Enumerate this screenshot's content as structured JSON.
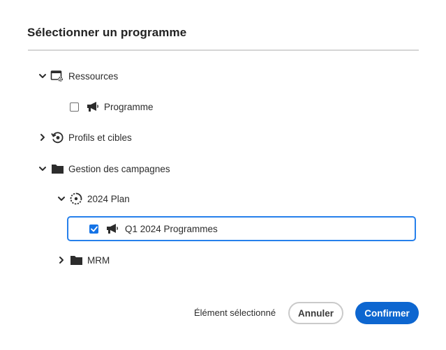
{
  "dialog": {
    "title": "Sélectionner un programme"
  },
  "tree": {
    "resources": {
      "label": "Ressources",
      "expanded": true,
      "icon": "resource-settings-icon",
      "children": {
        "programme": {
          "label": "Programme",
          "checked": false,
          "icon": "megaphone-icon"
        }
      }
    },
    "profiles": {
      "label": "Profils et cibles",
      "expanded": false,
      "icon": "history-target-icon"
    },
    "campaigns": {
      "label": "Gestion des campagnes",
      "expanded": true,
      "icon": "folder-icon",
      "children": {
        "plan": {
          "label": "2024 Plan",
          "expanded": true,
          "icon": "plan-target-icon",
          "children": {
            "q1": {
              "label": "Q1 2024 Programmes",
              "checked": true,
              "icon": "megaphone-icon"
            }
          }
        },
        "mrm": {
          "label": "MRM",
          "expanded": false,
          "icon": "folder-icon"
        }
      }
    }
  },
  "footer": {
    "status": "Élément sélectionné",
    "cancel_label": "Annuler",
    "confirm_label": "Confirmer"
  },
  "colors": {
    "accent": "#1473e6",
    "confirm_button": "#0d66d0",
    "selection_border": "#2680eb"
  }
}
